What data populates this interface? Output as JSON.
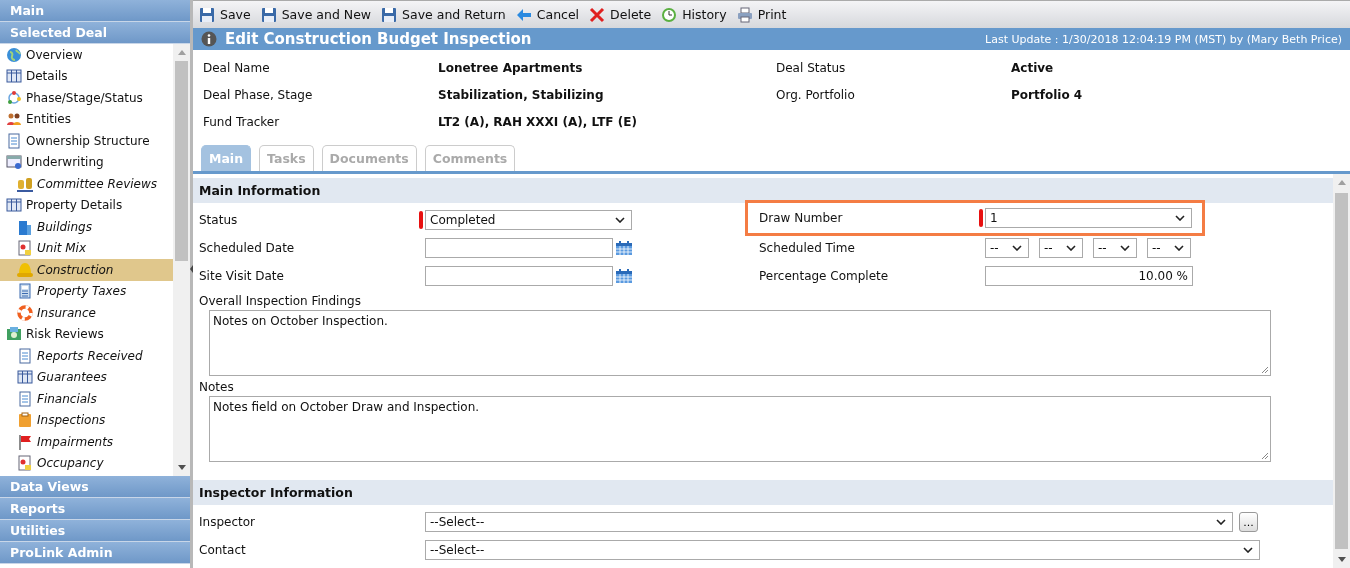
{
  "sidebar": {
    "top_headers": [
      {
        "label": "Main"
      },
      {
        "label": "Selected Deal"
      }
    ],
    "items": [
      {
        "label": "Overview",
        "selected": false
      },
      {
        "label": "Details",
        "selected": false
      },
      {
        "label": "Phase/Stage/Status",
        "selected": false
      },
      {
        "label": "Entities",
        "selected": false
      },
      {
        "label": "Ownership Structure",
        "selected": false
      },
      {
        "label": "Underwriting",
        "selected": false,
        "children": [
          {
            "label": "Committee Reviews",
            "selected": false
          }
        ]
      },
      {
        "label": "Property Details",
        "selected": false,
        "children": [
          {
            "label": "Buildings",
            "selected": false
          },
          {
            "label": "Unit Mix",
            "selected": false
          },
          {
            "label": "Construction",
            "selected": true
          },
          {
            "label": "Property Taxes",
            "selected": false
          },
          {
            "label": "Insurance",
            "selected": false
          }
        ]
      },
      {
        "label": "Risk Reviews",
        "selected": false,
        "children": [
          {
            "label": "Reports Received",
            "selected": false
          },
          {
            "label": "Guarantees",
            "selected": false
          },
          {
            "label": "Financials",
            "selected": false
          },
          {
            "label": "Inspections",
            "selected": false
          },
          {
            "label": "Impairments",
            "selected": false
          },
          {
            "label": "Occupancy",
            "selected": false
          }
        ]
      }
    ],
    "bottom_headers": [
      {
        "label": "Data Views"
      },
      {
        "label": "Reports"
      },
      {
        "label": "Utilities"
      },
      {
        "label": "ProLink Admin"
      }
    ]
  },
  "toolbar": [
    {
      "label": "Save"
    },
    {
      "label": "Save and New"
    },
    {
      "label": "Save and Return"
    },
    {
      "label": "Cancel"
    },
    {
      "label": "Delete"
    },
    {
      "label": "History"
    },
    {
      "label": "Print"
    }
  ],
  "header": {
    "title": "Edit Construction Budget Inspection",
    "last_update": "Last Update : 1/30/2018 12:04:19 PM (MST) by (Mary Beth Price)"
  },
  "deal_info": [
    {
      "label": "Deal Name",
      "value": "Lonetree Apartments"
    },
    {
      "label": "Deal Status",
      "value": "Active"
    },
    {
      "label": "Deal Phase, Stage",
      "value": "Stabilization, Stabilizing"
    },
    {
      "label": "Org. Portfolio",
      "value": "Portfolio 4"
    },
    {
      "label": "Fund Tracker",
      "value": "LT2 (A), RAH XXXI (A), LTF (E)"
    }
  ],
  "tabs": [
    {
      "label": "Main",
      "selected": true
    },
    {
      "label": "Tasks",
      "selected": false
    },
    {
      "label": "Documents",
      "selected": false
    },
    {
      "label": "Comments",
      "selected": false
    }
  ],
  "sections": [
    {
      "title": "Main Information",
      "fields": [
        {
          "kind": "select",
          "label": "Status",
          "value": "Completed",
          "required": true,
          "highlighted": false
        },
        {
          "kind": "select",
          "label": "Draw Number",
          "value": "1",
          "required": true,
          "highlighted": true
        },
        {
          "kind": "date",
          "label": "Scheduled Date",
          "required": false,
          "highlighted": false
        },
        {
          "kind": "time",
          "label": "Scheduled Time",
          "values": [
            "--",
            "--",
            "--",
            "--"
          ],
          "required": false,
          "highlighted": false
        },
        {
          "kind": "date",
          "label": "Site Visit Date",
          "required": false,
          "highlighted": false
        },
        {
          "kind": "number",
          "label": "Percentage Complete",
          "value": "10.00 %",
          "required": false,
          "highlighted": false
        },
        {
          "kind": "textarea",
          "label": "Overall Inspection Findings",
          "value": "Notes on October Inspection."
        },
        {
          "kind": "textarea",
          "label": "Notes",
          "value": "Notes field on October Draw and Inspection."
        }
      ]
    },
    {
      "title": "Inspector Information",
      "fields": [
        {
          "kind": "lookup",
          "label": "Inspector",
          "value": "--Select--",
          "button": "..."
        },
        {
          "kind": "wide-select",
          "label": "Contact",
          "value": "--Select--"
        }
      ]
    }
  ]
}
